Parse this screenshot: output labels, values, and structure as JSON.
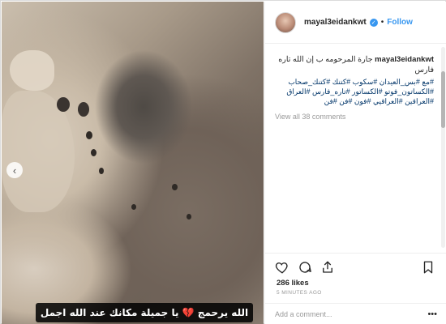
{
  "post": {
    "username": "mayal3eidankwt",
    "follow_label": "Follow",
    "separator": "•",
    "caption_user": "mayal3eidankwt",
    "caption_text": "جارة المرحومه ب إن الله تاره فارس",
    "hashtags": "#مع #بس_العيدان #سكوب #كتنك #كتنك_صحاب #الكساتون_فوتو #الكساتور #تاره_فارس #العراق #العراقين #العراقيي #فون #فن #فن",
    "view_all_comments": "View all 38 comments",
    "likes": "286 likes",
    "time": "5 MINUTES AGO",
    "comment_placeholder": "Add a comment...",
    "more_label": "•••"
  },
  "media": {
    "overlay_text": "الله يرحمج 💔 يا جميلة مكانك عند الله اجمل",
    "prev_label": "‹"
  },
  "icons": {
    "verified": "verified-badge-icon",
    "like": "heart-icon",
    "comment": "comment-icon",
    "share": "share-icon",
    "save": "bookmark-icon"
  },
  "colors": {
    "accent": "#3897f0",
    "hashtag": "#003569",
    "muted": "#999999"
  }
}
